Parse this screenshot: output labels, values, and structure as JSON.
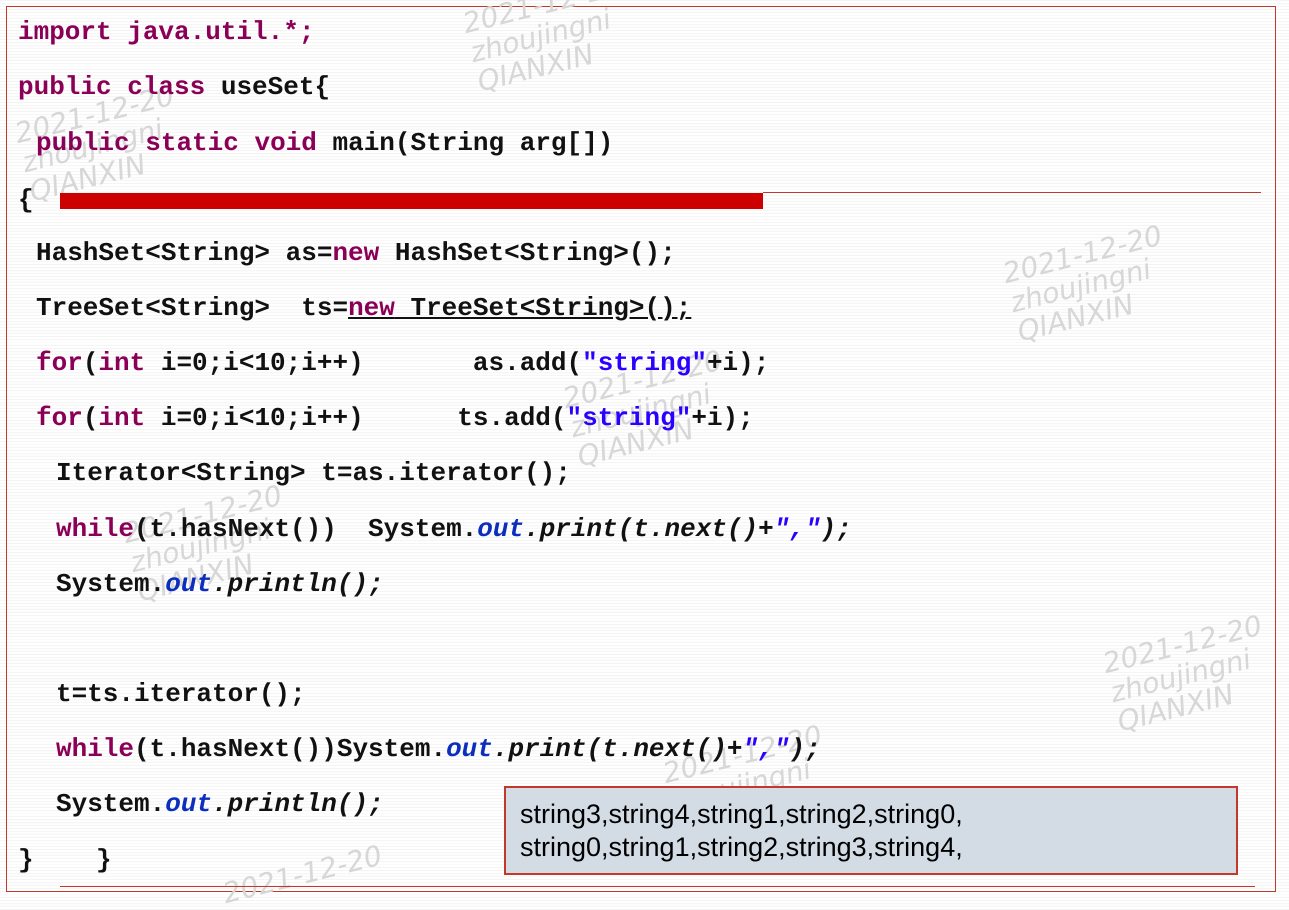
{
  "code": {
    "l1": "import java.util.*;",
    "l2": "public class useSet{",
    "l3_kw1": "public",
    "l3_kw2": "static",
    "l3_kw3": "void",
    "l3_rest": "main(String arg[])",
    "l4": "{",
    "l5_a": "HashSet<String> as=",
    "l5_new": "new",
    "l5_b": " HashSet<String>();",
    "l6_a": "TreeSet<String>  ts=",
    "l6_new": "new",
    "l6_b": " TreeSet<String>();",
    "l7_for": "for",
    "l7_a": "(",
    "l7_int": "int",
    "l7_b": " i=0;i<10;i++)       as.add(",
    "l7_str": "\"string\"",
    "l7_c": "+i);",
    "l8_for": "for",
    "l8_a": "(",
    "l8_int": "int",
    "l8_b": " i=0;i<10;i++)      ts.add(",
    "l8_str": "\"string\"",
    "l8_c": "+i);",
    "l9": "Iterator<String> t=as.iterator();",
    "l10_while": "while",
    "l10_a": "(t.hasNext())  System.",
    "l10_out": "out",
    "l10_b": ".print(t.next()+",
    "l10_str": "\",\"",
    "l10_c": ");",
    "l11_a": "System.",
    "l11_out": "out",
    "l11_b": ".println();",
    "l12": "t=ts.iterator();",
    "l13_while": "while",
    "l13_a": "(t.hasNext())System.",
    "l13_out": "out",
    "l13_b": ".print(t.next()+",
    "l13_str": "\",\"",
    "l13_c": ");",
    "l14_a": "System.",
    "l14_out": "out",
    "l14_b": ".println();",
    "l15": "}    }"
  },
  "output": {
    "line1": "string3,string4,string1,string2,string0,",
    "line2": "string0,string1,string2,string3,string4,"
  },
  "watermark": {
    "date": "2021-12-20",
    "user": "zhoujingni",
    "org": "QIANXIN"
  },
  "colors": {
    "keyword": "#8b0057",
    "string": "#2a00ff",
    "field": "#0c2ebd",
    "accent_red": "#cc0000"
  }
}
